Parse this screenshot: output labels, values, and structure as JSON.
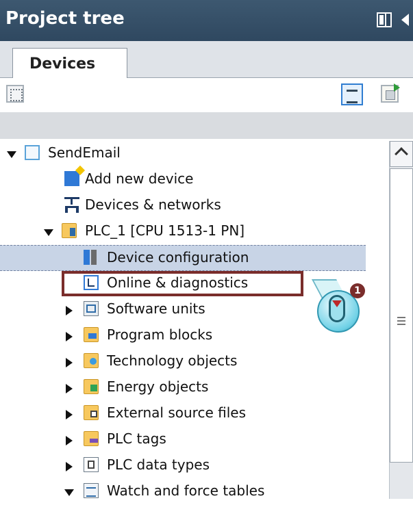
{
  "header": {
    "title": "Project tree"
  },
  "tabs": [
    {
      "label": "Devices"
    }
  ],
  "tree": [
    {
      "label": "SendEmail",
      "icon": "project-icon",
      "indent": 0,
      "expander": "down"
    },
    {
      "label": "Add new device",
      "icon": "add-device-icon",
      "indent": 1,
      "expander": "none"
    },
    {
      "label": "Devices & networks",
      "icon": "network-icon",
      "indent": 1,
      "expander": "none"
    },
    {
      "label": "PLC_1 [CPU 1513-1 PN]",
      "icon": "plc-folder-icon",
      "indent": 1,
      "expander": "down"
    },
    {
      "label": "Device configuration",
      "icon": "device-config-icon",
      "indent": 2,
      "expander": "none",
      "selected": true
    },
    {
      "label": "Online & diagnostics",
      "icon": "diagnostics-icon",
      "indent": 2,
      "expander": "none",
      "highlighted": true
    },
    {
      "label": "Software units",
      "icon": "software-units-icon",
      "indent": 2,
      "expander": "right"
    },
    {
      "label": "Program blocks",
      "icon": "program-blocks-icon",
      "indent": 2,
      "expander": "right"
    },
    {
      "label": "Technology objects",
      "icon": "technology-objects-icon",
      "indent": 2,
      "expander": "right"
    },
    {
      "label": "Energy objects",
      "icon": "energy-objects-icon",
      "indent": 2,
      "expander": "right"
    },
    {
      "label": "External source files",
      "icon": "external-files-icon",
      "indent": 2,
      "expander": "right"
    },
    {
      "label": "PLC tags",
      "icon": "plc-tags-icon",
      "indent": 2,
      "expander": "right"
    },
    {
      "label": "PLC data types",
      "icon": "plc-data-types-icon",
      "indent": 2,
      "expander": "right"
    },
    {
      "label": "Watch and force tables",
      "icon": "watch-tables-icon",
      "indent": 2,
      "expander": "down"
    }
  ],
  "callout": {
    "step": "1",
    "action": "double-click"
  },
  "colors": {
    "header": "#2f4860",
    "selection": "#c8d4e6",
    "highlight": "#7a2d2b"
  }
}
